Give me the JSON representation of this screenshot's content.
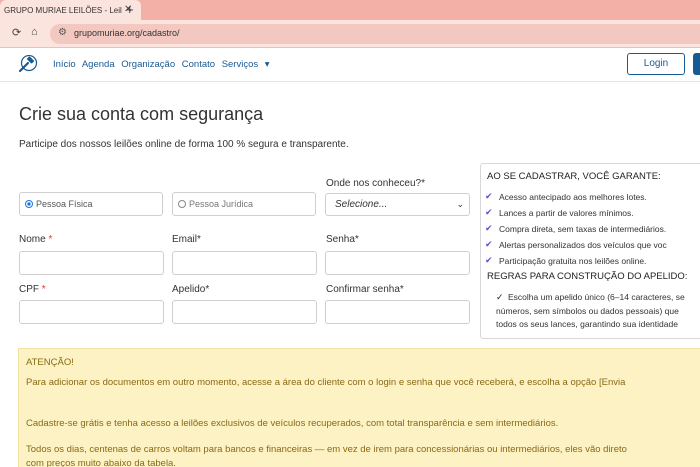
{
  "browser": {
    "tab_title": "GRUPO MURIAE LEILÕES - Leil",
    "tab_close": "✕",
    "new_tab": "+",
    "url": "grupomuriae.org/cadastro/",
    "back_icon": "refresh-icon",
    "home_icon": "home-icon"
  },
  "navbar": {
    "items": [
      "Início",
      "Agenda",
      "Organização",
      "Contato",
      "Serviços"
    ],
    "services_caret": "▾",
    "login": "Login"
  },
  "page": {
    "title": "Crie sua conta com segurança",
    "subtitle": "Participe dos nossos leilões online de forma 100 % segura e transparente."
  },
  "form": {
    "person_type": {
      "options": [
        "Pessoa Física",
        "Pessoa Jurídica"
      ],
      "selected": "Pessoa Física"
    },
    "source": {
      "label": "Onde nos conheceu?*",
      "value": "Selecione...",
      "caret": "⌄"
    },
    "nome": {
      "label": "Nome ",
      "req": "*"
    },
    "email": {
      "label": "Email*"
    },
    "senha": {
      "label": "Senha*"
    },
    "cpf": {
      "label": "CPF ",
      "req": "*"
    },
    "apelido": {
      "label": "Apelido*"
    },
    "confirmar": {
      "label": "Confirmar senha*"
    }
  },
  "benefits": {
    "heading": "AO SE CADASTRAR, VOCÊ GARANTE:",
    "items": [
      "Acesso antecipado aos melhores lotes.",
      "Lances a partir de valores mínimos.",
      "Compra direta, sem taxas de intermediários.",
      "Alertas personalizados dos veículos que voc",
      "Participação gratuita nos leilões online."
    ],
    "check_glyph": "✔",
    "rules_heading": "REGRAS PARA CONSTRUÇÃO DO APELIDO:",
    "rule_check": "✓",
    "rule_lines": [
      "Escolha um apelido único (6–14 caracteres, se",
      "números, sem símbolos ou dados pessoais) que",
      "todos os seus lances, garantindo sua identidade"
    ]
  },
  "attention": {
    "heading": "ATENÇÃO!",
    "line1": "Para adicionar os documentos em outro momento, acesse a área do cliente com o login e senha que você receberá, e escolha a opção [Envia",
    "line2": "Cadastre-se grátis e tenha acesso a leilões exclusivos de veículos recuperados, com total transparência e sem intermediários.",
    "line3": "Todos os dias, centenas de carros voltam para bancos e financeiras — em vez de irem para concessionárias ou intermediários, eles vão direto",
    "line4": "com preços muito abaixo da tabela."
  },
  "colors": {
    "brand": "#1a5a93",
    "attention_bg": "#fdf2c4",
    "check": "#6a4fc1"
  }
}
